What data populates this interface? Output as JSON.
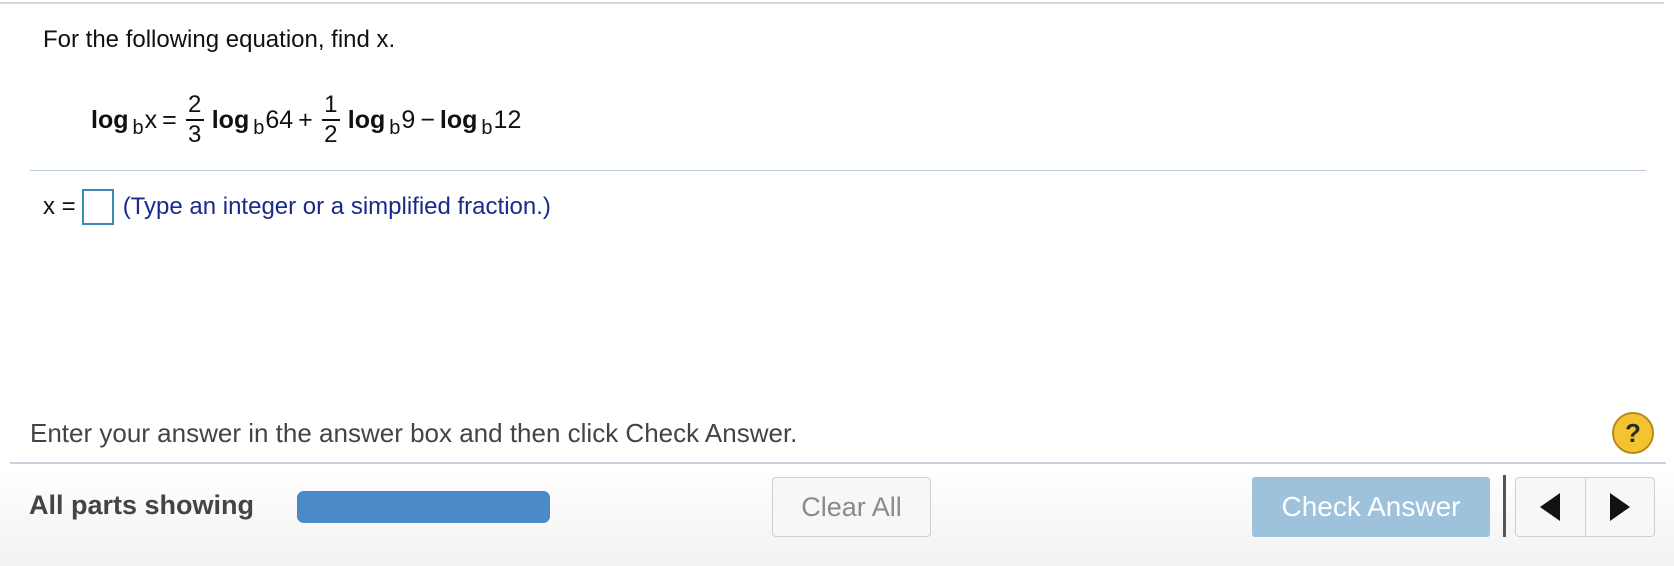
{
  "question": {
    "prompt": "For the following equation, find x."
  },
  "equation": {
    "log": "log",
    "base": "b",
    "lhs_arg": "x",
    "equals": "=",
    "term1": {
      "num": "2",
      "den": "3",
      "arg": "64"
    },
    "plus": "+",
    "term2": {
      "num": "1",
      "den": "2",
      "arg": "9"
    },
    "minus": "−",
    "term3": {
      "arg": "12"
    }
  },
  "answer": {
    "label": "x =",
    "value": "",
    "hint": "(Type an integer or a simplified fraction.)"
  },
  "instructions": "Enter your answer in the answer box and then click Check Answer.",
  "help": {
    "label": "?"
  },
  "footer": {
    "parts_label": "All parts showing",
    "progress_fraction": 1.0,
    "clear_label": "Clear All",
    "check_label": "Check Answer"
  },
  "colors": {
    "accent_blue": "#4a8ac6",
    "check_disabled": "#9ec1dc",
    "hint_text": "#1a2a8c",
    "help_yellow": "#f4c430"
  },
  "icons": {
    "help": "question-mark-icon",
    "prev": "triangle-left-icon",
    "next": "triangle-right-icon"
  }
}
